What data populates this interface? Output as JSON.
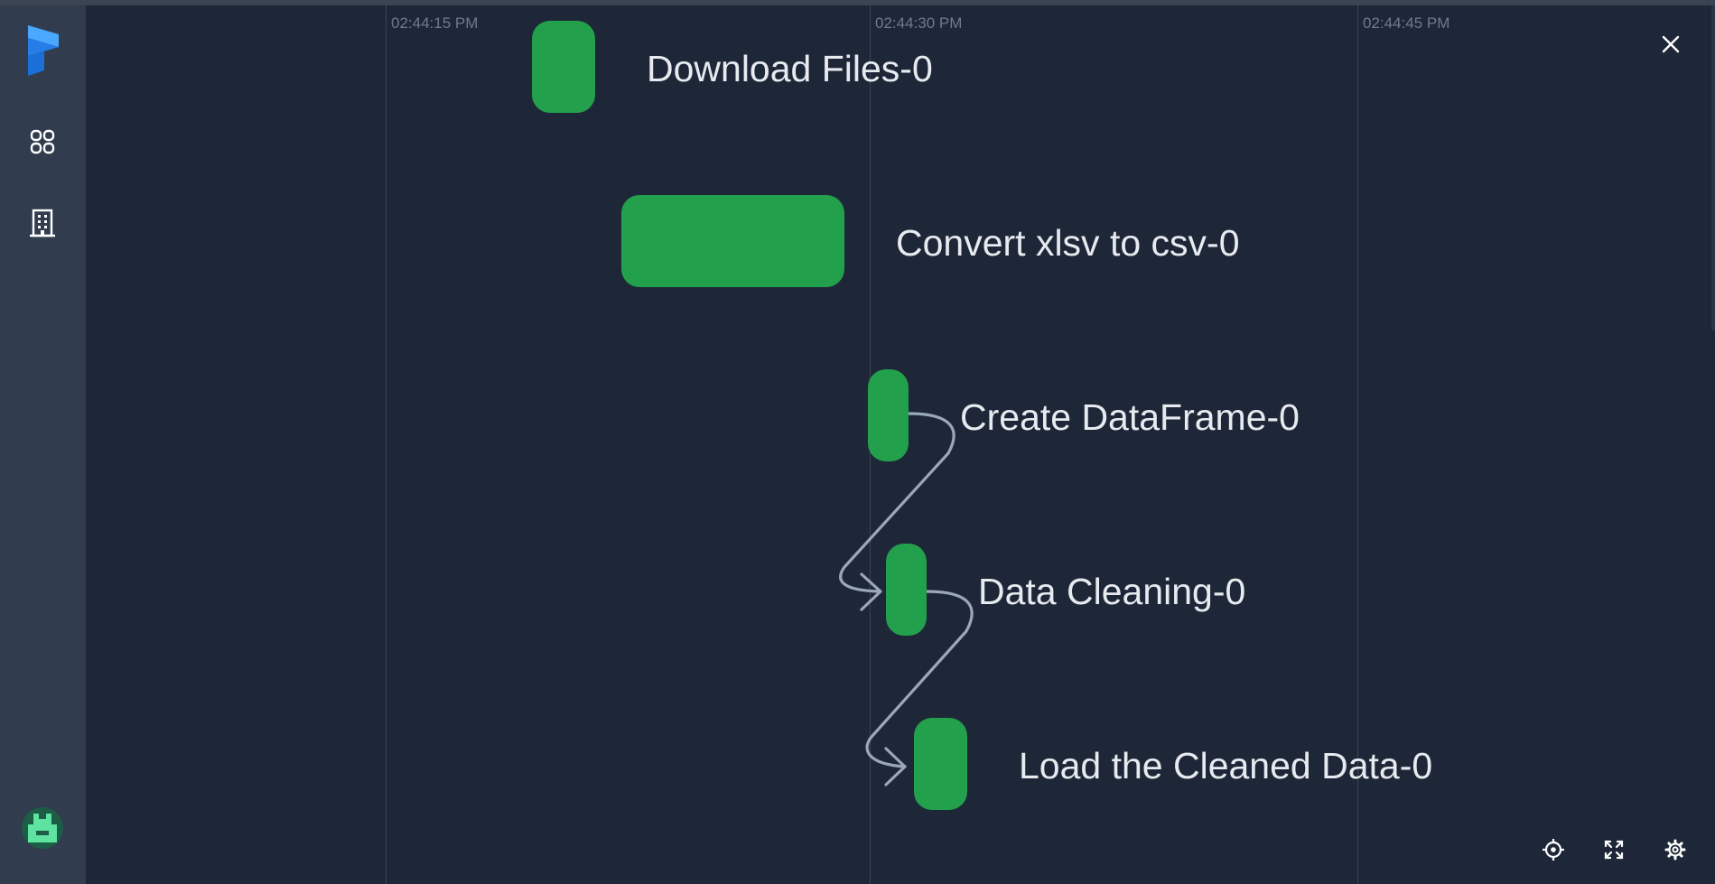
{
  "timeline": {
    "ticks": [
      "02:44:15 PM",
      "02:44:30 PM",
      "02:44:45 PM"
    ]
  },
  "tasks": [
    {
      "name": "Download Files-0",
      "state": "completed"
    },
    {
      "name": "Convert xlsv to csv-0",
      "state": "completed"
    },
    {
      "name": "Create DataFrame-0",
      "state": "completed"
    },
    {
      "name": "Data Cleaning-0",
      "state": "completed"
    },
    {
      "name": "Load the Cleaned Data-0",
      "state": "completed"
    }
  ],
  "colors": {
    "background": "#1e2738",
    "sidebar": "#313d4e",
    "completed": "#22a04c",
    "edge": "#9aa8bb",
    "brand": "#2b8ef0",
    "avatar": "#5fe3a1"
  },
  "icons": {
    "logo": "prefect-logo-icon",
    "dashboard": "dashboard-grid-icon",
    "workspace": "building-icon",
    "avatar": "user-avatar-icon",
    "close": "close-icon",
    "recenter": "recenter-icon",
    "fullscreen": "fullscreen-icon",
    "settings": "gear-icon"
  }
}
